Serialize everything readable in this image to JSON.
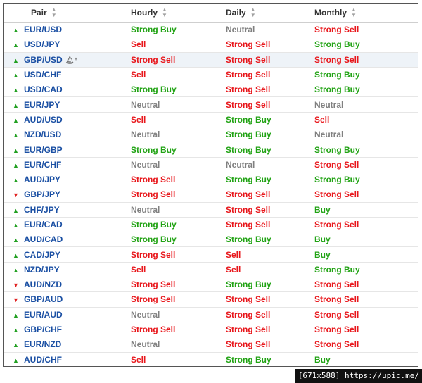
{
  "columns": {
    "pair": "Pair",
    "hourly": "Hourly",
    "daily": "Daily",
    "monthly": "Monthly"
  },
  "rows": [
    {
      "pair": "EUR/USD",
      "trend": "up",
      "hourly": "Strong Buy",
      "daily": "Neutral",
      "monthly": "Strong Sell"
    },
    {
      "pair": "USD/JPY",
      "trend": "up",
      "hourly": "Sell",
      "daily": "Strong Sell",
      "monthly": "Strong Buy"
    },
    {
      "pair": "GBP/USD",
      "trend": "up",
      "hourly": "Strong Sell",
      "daily": "Strong Sell",
      "monthly": "Strong Sell",
      "highlight": true,
      "bell": true
    },
    {
      "pair": "USD/CHF",
      "trend": "up",
      "hourly": "Sell",
      "daily": "Strong Sell",
      "monthly": "Strong Buy"
    },
    {
      "pair": "USD/CAD",
      "trend": "up",
      "hourly": "Strong Buy",
      "daily": "Strong Sell",
      "monthly": "Strong Buy"
    },
    {
      "pair": "EUR/JPY",
      "trend": "up",
      "hourly": "Neutral",
      "daily": "Strong Sell",
      "monthly": "Neutral"
    },
    {
      "pair": "AUD/USD",
      "trend": "up",
      "hourly": "Sell",
      "daily": "Strong Buy",
      "monthly": "Sell"
    },
    {
      "pair": "NZD/USD",
      "trend": "up",
      "hourly": "Neutral",
      "daily": "Strong Buy",
      "monthly": "Neutral"
    },
    {
      "pair": "EUR/GBP",
      "trend": "up",
      "hourly": "Strong Buy",
      "daily": "Strong Buy",
      "monthly": "Strong Buy"
    },
    {
      "pair": "EUR/CHF",
      "trend": "up",
      "hourly": "Neutral",
      "daily": "Neutral",
      "monthly": "Strong Sell"
    },
    {
      "pair": "AUD/JPY",
      "trend": "up",
      "hourly": "Strong Sell",
      "daily": "Strong Buy",
      "monthly": "Strong Buy"
    },
    {
      "pair": "GBP/JPY",
      "trend": "down",
      "hourly": "Strong Sell",
      "daily": "Strong Sell",
      "monthly": "Strong Sell"
    },
    {
      "pair": "CHF/JPY",
      "trend": "up",
      "hourly": "Neutral",
      "daily": "Strong Sell",
      "monthly": "Buy"
    },
    {
      "pair": "EUR/CAD",
      "trend": "up",
      "hourly": "Strong Buy",
      "daily": "Strong Sell",
      "monthly": "Strong Sell"
    },
    {
      "pair": "AUD/CAD",
      "trend": "up",
      "hourly": "Strong Buy",
      "daily": "Strong Buy",
      "monthly": "Buy"
    },
    {
      "pair": "CAD/JPY",
      "trend": "up",
      "hourly": "Strong Sell",
      "daily": "Sell",
      "monthly": "Buy"
    },
    {
      "pair": "NZD/JPY",
      "trend": "up",
      "hourly": "Sell",
      "daily": "Sell",
      "monthly": "Strong Buy"
    },
    {
      "pair": "AUD/NZD",
      "trend": "down",
      "hourly": "Strong Sell",
      "daily": "Strong Buy",
      "monthly": "Strong Sell"
    },
    {
      "pair": "GBP/AUD",
      "trend": "down",
      "hourly": "Strong Sell",
      "daily": "Strong Sell",
      "monthly": "Strong Sell"
    },
    {
      "pair": "EUR/AUD",
      "trend": "up",
      "hourly": "Neutral",
      "daily": "Strong Sell",
      "monthly": "Strong Sell"
    },
    {
      "pair": "GBP/CHF",
      "trend": "up",
      "hourly": "Strong Sell",
      "daily": "Strong Sell",
      "monthly": "Strong Sell"
    },
    {
      "pair": "EUR/NZD",
      "trend": "up",
      "hourly": "Neutral",
      "daily": "Strong Sell",
      "monthly": "Strong Sell"
    },
    {
      "pair": "AUD/CHF",
      "trend": "up",
      "hourly": "Sell",
      "daily": "Strong Buy",
      "monthly": "Buy"
    }
  ],
  "watermark": "[671x588] https://upic.me/",
  "colors": {
    "buy": "#21a314",
    "sell": "#e8161b",
    "neutral": "#808080",
    "link": "#1a4fa3"
  }
}
